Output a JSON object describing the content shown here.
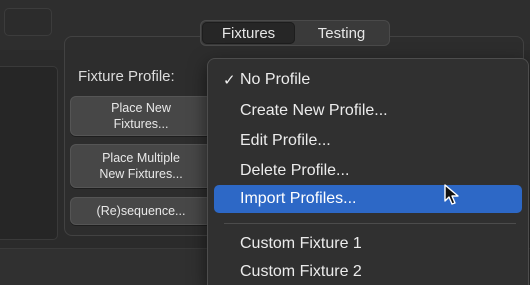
{
  "tabs": {
    "items": [
      {
        "label": "Fixtures",
        "selected": true
      },
      {
        "label": "Testing",
        "selected": false
      }
    ]
  },
  "fixture_profile": {
    "label": "Fixture Profile:"
  },
  "buttons": {
    "place_new": "Place New\nFixtures...",
    "place_multiple": "Place Multiple\nNew Fixtures...",
    "resequence": "(Re)sequence..."
  },
  "menu": {
    "items": [
      {
        "label": "No Profile",
        "checked": true
      },
      {
        "label": "Create New Profile..."
      },
      {
        "label": "Edit Profile..."
      },
      {
        "label": "Delete Profile..."
      },
      {
        "label": "Import Profiles...",
        "highlighted": true
      },
      {
        "label": "Custom Fixture 1"
      },
      {
        "label": "Custom Fixture 2"
      }
    ],
    "check_glyph": "✓",
    "highlight_color": "#2d68c6"
  }
}
